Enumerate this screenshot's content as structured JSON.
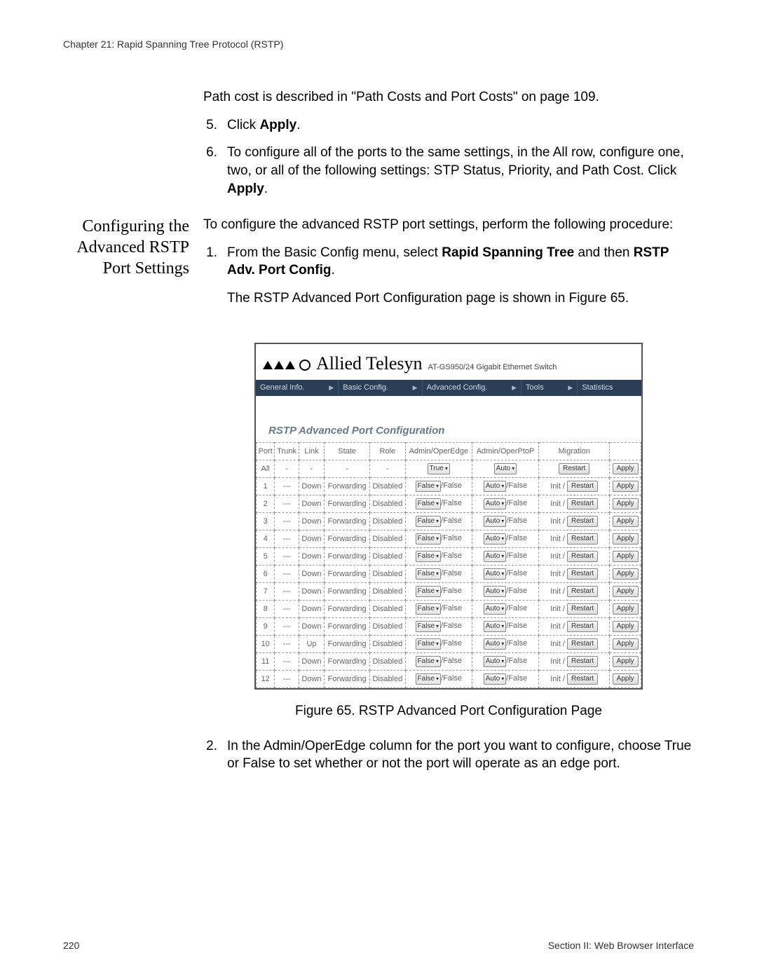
{
  "chapter_header": "Chapter 21: Rapid Spanning Tree Protocol (RSTP)",
  "intro": {
    "path_cost_note": "Path cost is described in \"Path Costs and Port Costs\" on page 109.",
    "step5_num": "5.",
    "step5_a": "Click ",
    "step5_b": "Apply",
    "step5_c": ".",
    "step6_num": "6.",
    "step6_a": "To configure all of the ports to the same settings, in the All row, configure one, two, or all of the following settings: STP Status, Priority, and Path Cost. Click ",
    "step6_b": "Apply",
    "step6_c": "."
  },
  "section_heading": "Configuring the Advanced RSTP Port Settings",
  "section": {
    "lead": "To configure the advanced RSTP port settings, perform the following procedure:",
    "s1_num": "1.",
    "s1_a": "From the Basic Config menu, select ",
    "s1_b": "Rapid Spanning Tree",
    "s1_c": " and then ",
    "s1_d": "RSTP Adv. Port Config",
    "s1_e": ".",
    "fig_intro": "The RSTP Advanced Port Configuration page is shown in Figure 65.",
    "fig_caption": "Figure 65. RSTP Advanced Port Configuration Page",
    "s2_num": "2.",
    "s2_text": "In the Admin/OperEdge column for the port you want to configure, choose True or False to set whether or not the port will operate as an edge port."
  },
  "shot": {
    "brand": "Allied Telesyn",
    "model": "AT-GS950/24 Gigabit Ethernet Switch",
    "nav": [
      "General Info.",
      "Basic Config.",
      "Advanced Config.",
      "Tools",
      "Statistics"
    ],
    "title": "RSTP Advanced Port Configuration",
    "headers": [
      "Port",
      "Trunk",
      "Link",
      "State",
      "Role",
      "Admin/OperEdge",
      "Admin/OperPtoP",
      "Migration",
      ""
    ],
    "all_row": {
      "port": "All",
      "trunk": "-",
      "link": "-",
      "state": "-",
      "role": "-",
      "edge_sel": "True",
      "ptop_sel": "Auto",
      "mig_btn": "Restart",
      "apply": "Apply"
    },
    "edge_oper": "/False",
    "ptop_oper": "/False",
    "mig_label": "Init",
    "mig_sep": "/",
    "rows": [
      {
        "port": "1",
        "trunk": "---",
        "link": "Down",
        "state": "Forwarding",
        "role": "Disabled",
        "edge_sel": "False",
        "ptop_sel": "Auto",
        "mig_btn": "Restart",
        "apply": "Apply"
      },
      {
        "port": "2",
        "trunk": "---",
        "link": "Down",
        "state": "Forwarding",
        "role": "Disabled",
        "edge_sel": "False",
        "ptop_sel": "Auto",
        "mig_btn": "Restart",
        "apply": "Apply"
      },
      {
        "port": "3",
        "trunk": "---",
        "link": "Down",
        "state": "Forwarding",
        "role": "Disabled",
        "edge_sel": "False",
        "ptop_sel": "Auto",
        "mig_btn": "Restart",
        "apply": "Apply"
      },
      {
        "port": "4",
        "trunk": "---",
        "link": "Down",
        "state": "Forwarding",
        "role": "Disabled",
        "edge_sel": "False",
        "ptop_sel": "Auto",
        "mig_btn": "Restart",
        "apply": "Apply"
      },
      {
        "port": "5",
        "trunk": "---",
        "link": "Down",
        "state": "Forwarding",
        "role": "Disabled",
        "edge_sel": "False",
        "ptop_sel": "Auto",
        "mig_btn": "Restart",
        "apply": "Apply"
      },
      {
        "port": "6",
        "trunk": "---",
        "link": "Down",
        "state": "Forwarding",
        "role": "Disabled",
        "edge_sel": "False",
        "ptop_sel": "Auto",
        "mig_btn": "Restart",
        "apply": "Apply"
      },
      {
        "port": "7",
        "trunk": "---",
        "link": "Down",
        "state": "Forwarding",
        "role": "Disabled",
        "edge_sel": "False",
        "ptop_sel": "Auto",
        "mig_btn": "Restart",
        "apply": "Apply"
      },
      {
        "port": "8",
        "trunk": "---",
        "link": "Down",
        "state": "Forwarding",
        "role": "Disabled",
        "edge_sel": "False",
        "ptop_sel": "Auto",
        "mig_btn": "Restart",
        "apply": "Apply"
      },
      {
        "port": "9",
        "trunk": "---",
        "link": "Down",
        "state": "Forwarding",
        "role": "Disabled",
        "edge_sel": "False",
        "ptop_sel": "Auto",
        "mig_btn": "Restart",
        "apply": "Apply"
      },
      {
        "port": "10",
        "trunk": "---",
        "link": "Up",
        "state": "Forwarding",
        "role": "Disabled",
        "edge_sel": "False",
        "ptop_sel": "Auto",
        "mig_btn": "Restart",
        "apply": "Apply"
      },
      {
        "port": "11",
        "trunk": "---",
        "link": "Down",
        "state": "Forwarding",
        "role": "Disabled",
        "edge_sel": "False",
        "ptop_sel": "Auto",
        "mig_btn": "Restart",
        "apply": "Apply"
      },
      {
        "port": "12",
        "trunk": "---",
        "link": "Down",
        "state": "Forwarding",
        "role": "Disabled",
        "edge_sel": "False",
        "ptop_sel": "Auto",
        "mig_btn": "Restart",
        "apply": "Apply"
      }
    ]
  },
  "footer": {
    "page_num": "220",
    "section_label": "Section II: Web Browser Interface"
  }
}
